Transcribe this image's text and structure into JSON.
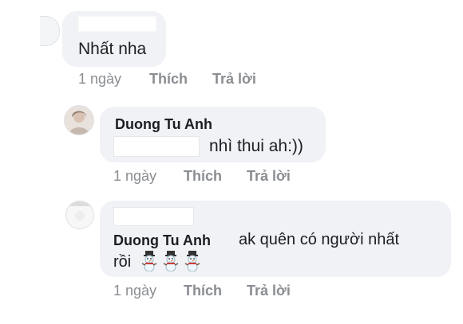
{
  "comments": [
    {
      "text": "Nhất nha",
      "time": "1 ngày",
      "like": "Thích",
      "reply": "Trả lời"
    },
    {
      "author": "Duong Tu Anh",
      "text": "nhì thui ah:))",
      "time": "1 ngày",
      "like": "Thích",
      "reply": "Trả lời"
    },
    {
      "author": "Duong Tu Anh",
      "text_line1": "ak quên có người nhất",
      "text_line2": "rồi",
      "emoji": [
        "snowman-icon",
        "snowman-icon",
        "snowman-icon"
      ],
      "time": "1 ngày",
      "like": "Thích",
      "reply": "Trả lời"
    }
  ],
  "colors": {
    "bubble": "#f0f2f5",
    "meta_text": "#8a8d91",
    "body_text": "#1c1e21"
  }
}
